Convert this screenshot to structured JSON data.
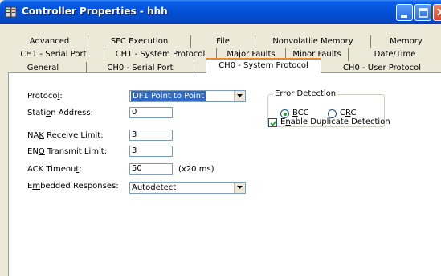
{
  "window": {
    "title": "Controller Properties - hhh",
    "icon": "controller-app-icon",
    "colors": {
      "titlebar": "#0553d8",
      "close_button": "#d4452b",
      "active_tab_accent": "#e68b2c"
    }
  },
  "tabs": {
    "row1": [
      "Advanced",
      "SFC Execution",
      "File",
      "Nonvolatile Memory",
      "Memory"
    ],
    "row2": [
      "CH1 - Serial Port",
      "CH1 - System Protocol",
      "Major Faults",
      "Minor Faults",
      "Date/Time"
    ],
    "row3": [
      "General",
      "CH0 - Serial Port",
      "CH0 - System Protocol",
      "CH0 - User Protocol"
    ],
    "active": "CH0 - System Protocol"
  },
  "form": {
    "protocol": {
      "label_pre": "Protoco",
      "label_u": "l",
      "label_post": ":",
      "value": "DF1 Point to Point"
    },
    "station_address": {
      "label_pre": "Stati",
      "label_u": "o",
      "label_post": "n Address:",
      "value": "0"
    },
    "nak_receive_limit": {
      "label_pre": "NA",
      "label_u": "K",
      "label_post": " Receive Limit:",
      "value": "3"
    },
    "enq_transmit_limit": {
      "label_pre": "EN",
      "label_u": "Q",
      "label_post": " Transmit Limit:",
      "value": "3"
    },
    "ack_timeout": {
      "label_pre": "ACK Timeou",
      "label_u": "t",
      "label_post": ":",
      "value": "50",
      "unit": "(x20 ms)"
    },
    "embedded_responses": {
      "label_pre": "E",
      "label_u": "m",
      "label_post": "bedded Responses:",
      "value": "Autodetect"
    }
  },
  "error_detection": {
    "title": "Error Detection",
    "bcc": {
      "label_u": "B",
      "label_post": "CC",
      "selected": true
    },
    "crc": {
      "label_pre": "C",
      "label_u": "R",
      "label_post": "C",
      "selected": false
    }
  },
  "duplicate_detection": {
    "label_pre": "E",
    "label_u": "n",
    "label_post": "able Duplicate Detection",
    "checked": true
  }
}
